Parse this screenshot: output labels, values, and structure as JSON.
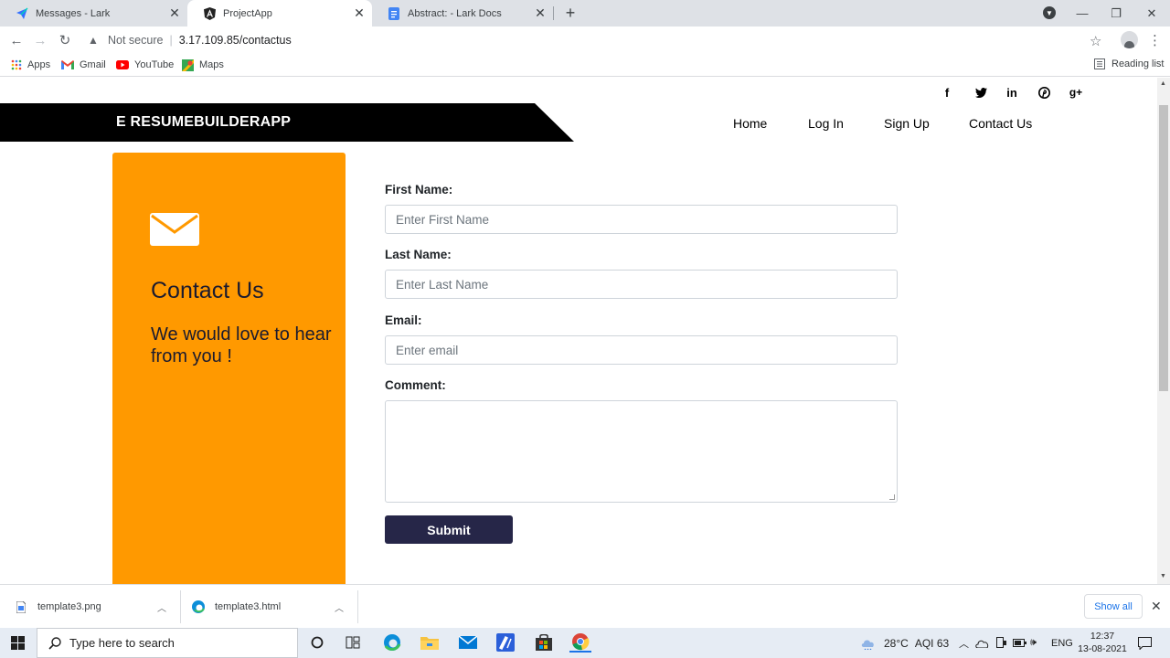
{
  "browser": {
    "tabs": [
      {
        "title": "Messages - Lark",
        "icon": "lark-icon"
      },
      {
        "title": "ProjectApp",
        "icon": "angular-icon",
        "active": true
      },
      {
        "title": "Abstract: - Lark Docs",
        "icon": "docs-icon"
      }
    ],
    "address": {
      "security_label": "Not secure",
      "url": "3.17.109.85/contactus"
    },
    "bookmarks": [
      {
        "label": "Apps",
        "icon": "apps-grid-icon"
      },
      {
        "label": "Gmail",
        "icon": "gmail-icon"
      },
      {
        "label": "YouTube",
        "icon": "youtube-icon"
      },
      {
        "label": "Maps",
        "icon": "maps-icon"
      }
    ],
    "reading_list": "Reading list"
  },
  "page": {
    "social_icons": [
      "facebook-icon",
      "twitter-icon",
      "linkedin-icon",
      "pinterest-icon",
      "google-plus-icon"
    ],
    "brand": "E RESUMEBUILDERAPP",
    "nav": [
      {
        "label": "Home"
      },
      {
        "label": "Log In"
      },
      {
        "label": "Sign Up"
      },
      {
        "label": "Contact Us"
      }
    ],
    "contact_panel": {
      "heading": "Contact Us",
      "subheading": "We would love to hear from you !",
      "color": "#ff9900"
    },
    "form": {
      "first_name": {
        "label": "First Name:",
        "placeholder": "Enter First Name"
      },
      "last_name": {
        "label": "Last Name:",
        "placeholder": "Enter Last Name"
      },
      "email": {
        "label": "Email:",
        "placeholder": "Enter email"
      },
      "comment": {
        "label": "Comment:"
      },
      "submit_label": "Submit",
      "submit_color": "#262648"
    }
  },
  "downloads": {
    "items": [
      {
        "filename": "template3.png"
      },
      {
        "filename": "template3.html"
      }
    ],
    "show_all": "Show all"
  },
  "taskbar": {
    "search_placeholder": "Type here to search",
    "weather": "28°C",
    "aqi": "AQI 63",
    "language": "ENG",
    "time": "12:37",
    "date": "13-08-2021"
  }
}
